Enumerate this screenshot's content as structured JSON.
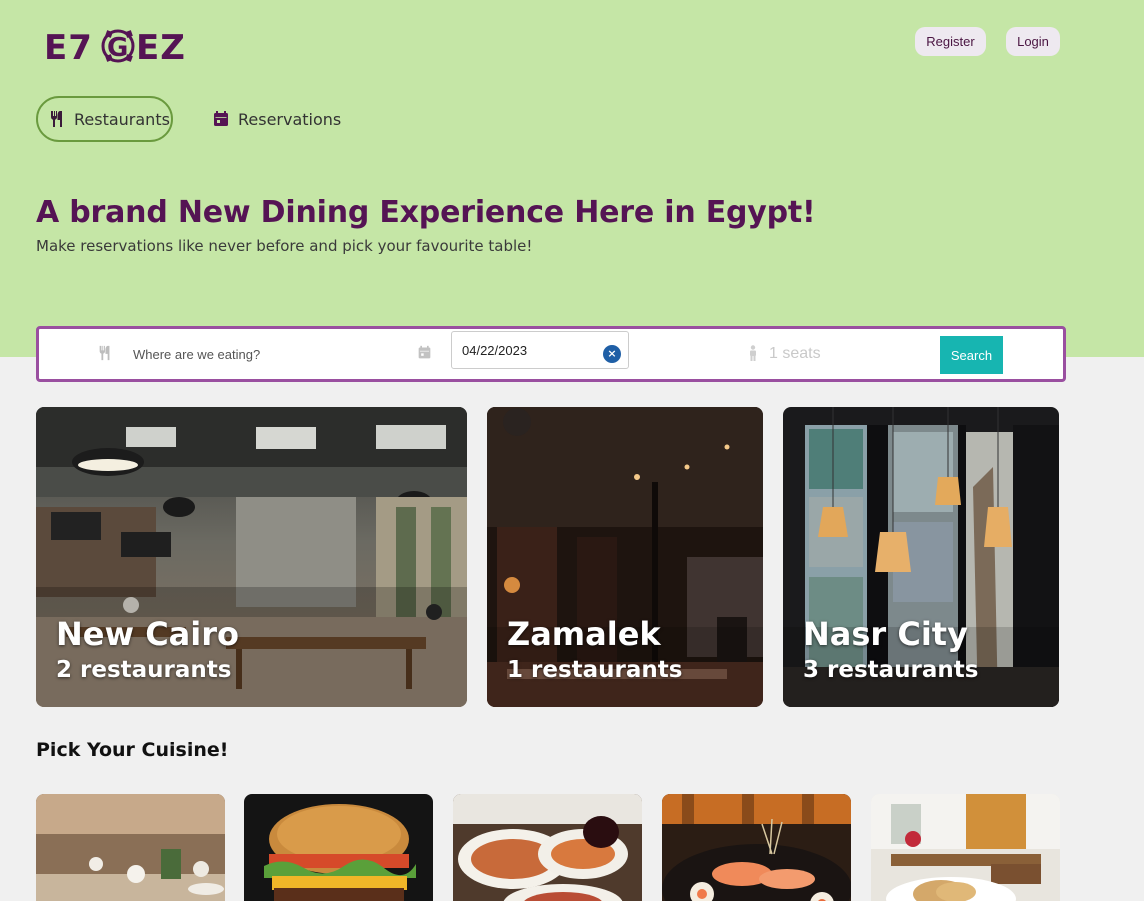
{
  "header": {
    "logo_text": "E7GEZ",
    "register_label": "Register",
    "login_label": "Login"
  },
  "nav": {
    "tabs": [
      {
        "label": "Restaurants",
        "icon": "fork-knife-icon",
        "active": true
      },
      {
        "label": "Reservations",
        "icon": "calendar-icon",
        "active": false
      }
    ]
  },
  "hero": {
    "title": "A brand New Dining Experience Here in Egypt!",
    "subtitle": "Make reservations like never before and pick your favourite table!"
  },
  "search": {
    "where_placeholder": "Where are we eating?",
    "date_value": "04/22/2023",
    "seats_label": "1 seats",
    "button_label": "Search"
  },
  "areas": [
    {
      "name": "New Cairo",
      "count": "2 restaurants"
    },
    {
      "name": "Zamalek",
      "count": "1 restaurants"
    },
    {
      "name": "Nasr City",
      "count": "3 restaurants"
    }
  ],
  "cuisine": {
    "heading": "Pick Your Cuisine!",
    "items": [
      "fine-dining-photo",
      "burger-photo",
      "grill-platter-photo",
      "sushi-photo",
      "cafe-photo"
    ]
  },
  "colors": {
    "hero_bg": "#c5e6a6",
    "brand_purple": "#551454",
    "search_border": "#9a4fa0",
    "search_button": "#17b5b1",
    "page_bg": "#f0f0f0"
  }
}
